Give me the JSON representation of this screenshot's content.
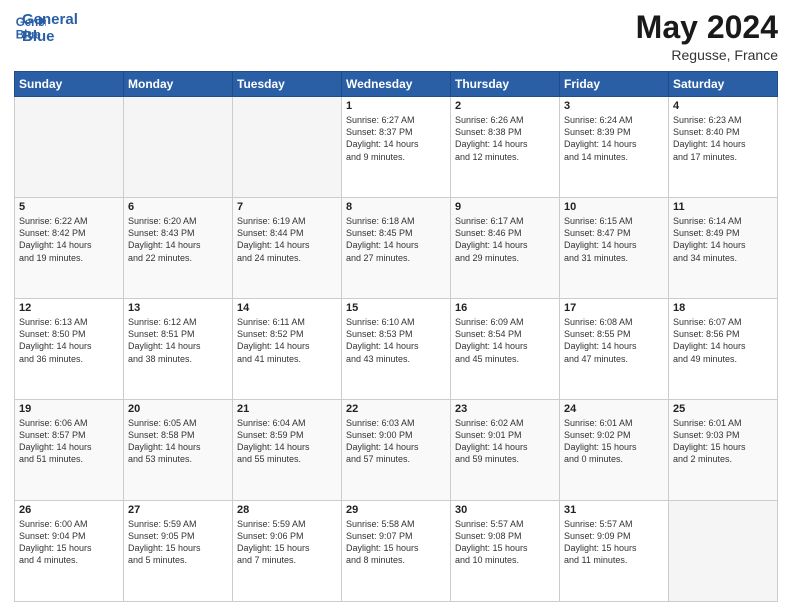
{
  "header": {
    "logo_line1": "General",
    "logo_line2": "Blue",
    "month": "May 2024",
    "location": "Regusse, France"
  },
  "columns": [
    "Sunday",
    "Monday",
    "Tuesday",
    "Wednesday",
    "Thursday",
    "Friday",
    "Saturday"
  ],
  "weeks": [
    [
      {
        "day": "",
        "info": ""
      },
      {
        "day": "",
        "info": ""
      },
      {
        "day": "",
        "info": ""
      },
      {
        "day": "1",
        "info": "Sunrise: 6:27 AM\nSunset: 8:37 PM\nDaylight: 14 hours\nand 9 minutes."
      },
      {
        "day": "2",
        "info": "Sunrise: 6:26 AM\nSunset: 8:38 PM\nDaylight: 14 hours\nand 12 minutes."
      },
      {
        "day": "3",
        "info": "Sunrise: 6:24 AM\nSunset: 8:39 PM\nDaylight: 14 hours\nand 14 minutes."
      },
      {
        "day": "4",
        "info": "Sunrise: 6:23 AM\nSunset: 8:40 PM\nDaylight: 14 hours\nand 17 minutes."
      }
    ],
    [
      {
        "day": "5",
        "info": "Sunrise: 6:22 AM\nSunset: 8:42 PM\nDaylight: 14 hours\nand 19 minutes."
      },
      {
        "day": "6",
        "info": "Sunrise: 6:20 AM\nSunset: 8:43 PM\nDaylight: 14 hours\nand 22 minutes."
      },
      {
        "day": "7",
        "info": "Sunrise: 6:19 AM\nSunset: 8:44 PM\nDaylight: 14 hours\nand 24 minutes."
      },
      {
        "day": "8",
        "info": "Sunrise: 6:18 AM\nSunset: 8:45 PM\nDaylight: 14 hours\nand 27 minutes."
      },
      {
        "day": "9",
        "info": "Sunrise: 6:17 AM\nSunset: 8:46 PM\nDaylight: 14 hours\nand 29 minutes."
      },
      {
        "day": "10",
        "info": "Sunrise: 6:15 AM\nSunset: 8:47 PM\nDaylight: 14 hours\nand 31 minutes."
      },
      {
        "day": "11",
        "info": "Sunrise: 6:14 AM\nSunset: 8:49 PM\nDaylight: 14 hours\nand 34 minutes."
      }
    ],
    [
      {
        "day": "12",
        "info": "Sunrise: 6:13 AM\nSunset: 8:50 PM\nDaylight: 14 hours\nand 36 minutes."
      },
      {
        "day": "13",
        "info": "Sunrise: 6:12 AM\nSunset: 8:51 PM\nDaylight: 14 hours\nand 38 minutes."
      },
      {
        "day": "14",
        "info": "Sunrise: 6:11 AM\nSunset: 8:52 PM\nDaylight: 14 hours\nand 41 minutes."
      },
      {
        "day": "15",
        "info": "Sunrise: 6:10 AM\nSunset: 8:53 PM\nDaylight: 14 hours\nand 43 minutes."
      },
      {
        "day": "16",
        "info": "Sunrise: 6:09 AM\nSunset: 8:54 PM\nDaylight: 14 hours\nand 45 minutes."
      },
      {
        "day": "17",
        "info": "Sunrise: 6:08 AM\nSunset: 8:55 PM\nDaylight: 14 hours\nand 47 minutes."
      },
      {
        "day": "18",
        "info": "Sunrise: 6:07 AM\nSunset: 8:56 PM\nDaylight: 14 hours\nand 49 minutes."
      }
    ],
    [
      {
        "day": "19",
        "info": "Sunrise: 6:06 AM\nSunset: 8:57 PM\nDaylight: 14 hours\nand 51 minutes."
      },
      {
        "day": "20",
        "info": "Sunrise: 6:05 AM\nSunset: 8:58 PM\nDaylight: 14 hours\nand 53 minutes."
      },
      {
        "day": "21",
        "info": "Sunrise: 6:04 AM\nSunset: 8:59 PM\nDaylight: 14 hours\nand 55 minutes."
      },
      {
        "day": "22",
        "info": "Sunrise: 6:03 AM\nSunset: 9:00 PM\nDaylight: 14 hours\nand 57 minutes."
      },
      {
        "day": "23",
        "info": "Sunrise: 6:02 AM\nSunset: 9:01 PM\nDaylight: 14 hours\nand 59 minutes."
      },
      {
        "day": "24",
        "info": "Sunrise: 6:01 AM\nSunset: 9:02 PM\nDaylight: 15 hours\nand 0 minutes."
      },
      {
        "day": "25",
        "info": "Sunrise: 6:01 AM\nSunset: 9:03 PM\nDaylight: 15 hours\nand 2 minutes."
      }
    ],
    [
      {
        "day": "26",
        "info": "Sunrise: 6:00 AM\nSunset: 9:04 PM\nDaylight: 15 hours\nand 4 minutes."
      },
      {
        "day": "27",
        "info": "Sunrise: 5:59 AM\nSunset: 9:05 PM\nDaylight: 15 hours\nand 5 minutes."
      },
      {
        "day": "28",
        "info": "Sunrise: 5:59 AM\nSunset: 9:06 PM\nDaylight: 15 hours\nand 7 minutes."
      },
      {
        "day": "29",
        "info": "Sunrise: 5:58 AM\nSunset: 9:07 PM\nDaylight: 15 hours\nand 8 minutes."
      },
      {
        "day": "30",
        "info": "Sunrise: 5:57 AM\nSunset: 9:08 PM\nDaylight: 15 hours\nand 10 minutes."
      },
      {
        "day": "31",
        "info": "Sunrise: 5:57 AM\nSunset: 9:09 PM\nDaylight: 15 hours\nand 11 minutes."
      },
      {
        "day": "",
        "info": ""
      }
    ]
  ]
}
